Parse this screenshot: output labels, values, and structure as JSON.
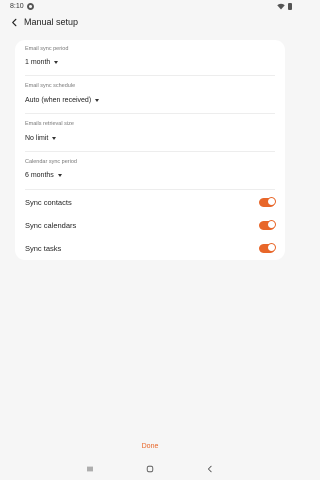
{
  "status_bar": {
    "time": "8:10",
    "icons": [
      "notification-icon",
      "wifi-icon",
      "battery-icon"
    ]
  },
  "app_bar": {
    "title": "Manual setup",
    "back_icon": "back-arrow-icon"
  },
  "settings": [
    {
      "label": "Email sync period",
      "value": "1 month"
    },
    {
      "label": "Email sync schedule",
      "value": "Auto (when received)"
    },
    {
      "label": "Emails retrieval size",
      "value": "No limit"
    },
    {
      "label": "Calendar sync period",
      "value": "6 months"
    }
  ],
  "toggles": [
    {
      "label": "Sync contacts",
      "on": true
    },
    {
      "label": "Sync calendars",
      "on": true
    },
    {
      "label": "Sync tasks",
      "on": true
    }
  ],
  "footer": {
    "done_label": "Done"
  },
  "nav_bar": {
    "icons": [
      "recents-icon",
      "home-icon",
      "back-icon"
    ]
  },
  "colors": {
    "accent": "#e8672a",
    "background": "#f6f6f6",
    "card": "#ffffff"
  }
}
